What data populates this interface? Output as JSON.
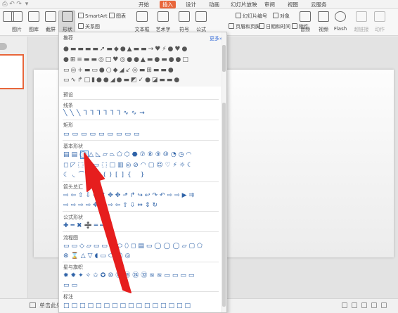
{
  "menu": {
    "tabs": [
      "开始",
      "插入",
      "设计",
      "动画",
      "幻灯片放映",
      "审阅",
      "视图",
      "云服务"
    ],
    "active_tab": "插入"
  },
  "ribbon": {
    "picture": "图片",
    "gallery": "图库",
    "screenshot": "截屏",
    "shape": "形状",
    "smartart": "SmartArt",
    "chart": "图表",
    "relation": "关系图",
    "textbox": "文本框",
    "wordart": "艺术字",
    "symbol": "符号",
    "formula": "公式",
    "slide_number": "幻灯片编号",
    "object": "对象",
    "header_footer": "页眉和页脚",
    "datetime": "日期和时间",
    "attachment": "附件",
    "audio": "音频",
    "video": "视频",
    "flash": "Flash",
    "hyperlink": "超链接",
    "action": "动作"
  },
  "panel": {
    "recommend": "推荐",
    "more": "更多»",
    "preset": "预设",
    "lines": "线条",
    "rectangles": "矩形",
    "basic_shapes": "基本形状",
    "block_arrows": "箭头总汇",
    "equation_shapes": "公式形状",
    "flowchart": "流程图",
    "stars_banners": "星与旗帜",
    "callouts": "标注"
  },
  "status": {
    "note": "单击此处"
  },
  "colors": {
    "accent": "#e8663b",
    "arrow": "#e61e1e",
    "link": "#3a6fd8"
  },
  "icons": {
    "shapes_rows": {
      "recommend": [
        "●▬▬▬▬➚▬◆●▲▬▬→♥⚡●♥●",
        "●⊞≡▬▬◎□♥◎●●▲▬●▬●●□",
        "▭◎+▬▭●○◆◢↙◎▬⊞▬▬●",
        "▭∿↱□▮●●◢●▬◩✓●◪▬▬●"
      ],
      "lines": "╲╲╲ᒣᒣᒣᒣᒣᒣ∿∿⇝",
      "rectangles": "▭▭▭▭▭▭▭▭▭",
      "basic1": "▤▤◯△◺▱⏢⬠⬡⬣⑦⑧⑨⑩◔◷◠",
      "basic2": "◻◸⬚✚▭⬚□▥◎⊘◠▢☺♡⚡☼☾",
      "basic3": "☾◟⌒{}()[]{ }",
      "arrows1": "⇨⇦⇧⇩⇔⇕✥✥⬏↱↪↩↷↶⇨⇨▶⇉",
      "arrows2": "⇨⇨⇨⇨✥✥⇨⇦⇧⇩⇔⇕↻",
      "equation": "✚━✖➗══",
      "flow1": "▭▭◇▱▭▭⬭⬭⬯◻▤▭◯◯◯▱▢⬠",
      "flow2": "⊗⌛△▽◖▭⬭◯◎",
      "stars1": "✹✸✦✧✩✪⑩⑫⑯㉔㉜≋≋▭▭▭▭",
      "stars2": "▭▭",
      "callouts": "□□□□□□□□□□□□□□□□"
    }
  }
}
